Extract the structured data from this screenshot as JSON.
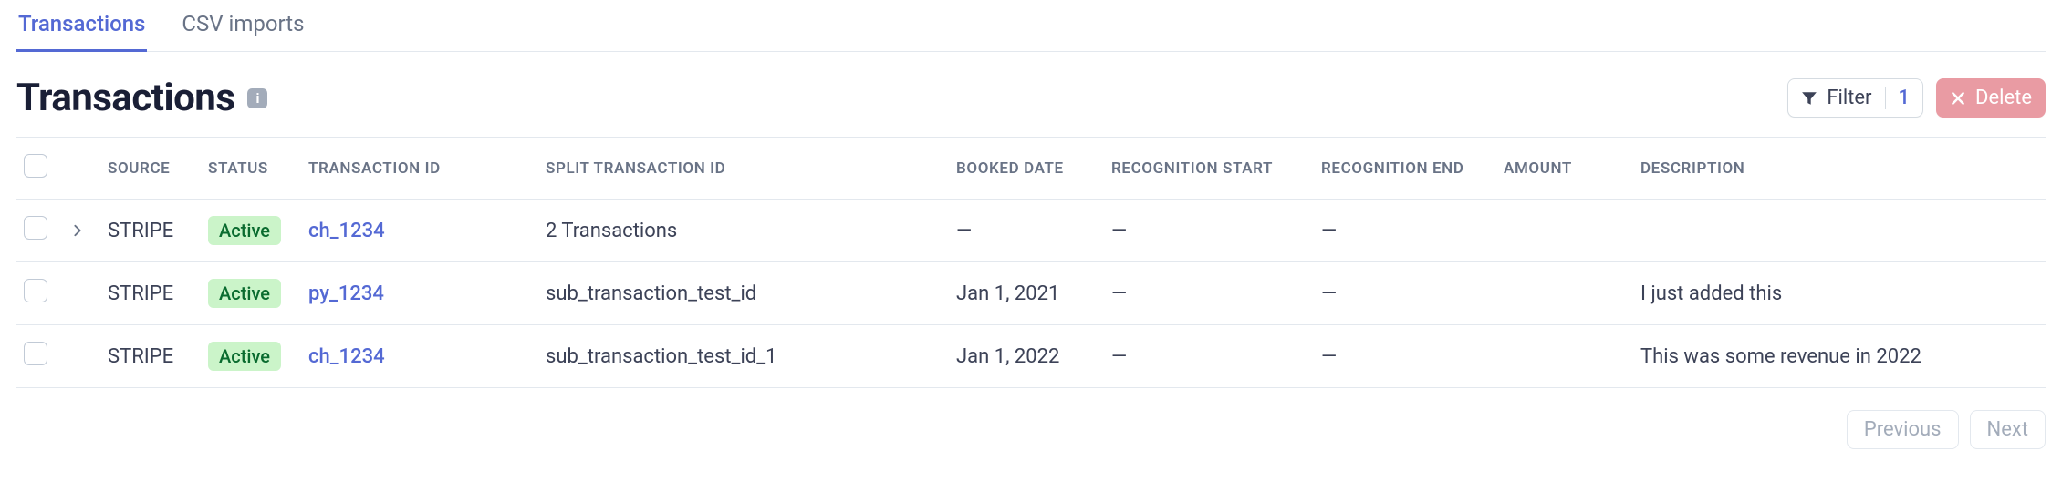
{
  "tabs": [
    {
      "label": "Transactions",
      "active": true
    },
    {
      "label": "CSV imports",
      "active": false
    }
  ],
  "header": {
    "title": "Transactions",
    "info_glyph": "i",
    "filter_label": "Filter",
    "filter_count": "1",
    "delete_label": "Delete"
  },
  "table": {
    "columns": {
      "source": "SOURCE",
      "status": "STATUS",
      "transaction_id": "TRANSACTION ID",
      "split_transaction_id": "SPLIT TRANSACTION ID",
      "booked_date": "BOOKED DATE",
      "recognition_start": "RECOGNITION START",
      "recognition_end": "RECOGNITION END",
      "amount": "AMOUNT",
      "description": "DESCRIPTION"
    },
    "rows": [
      {
        "expandable": true,
        "source": "STRIPE",
        "status": "Active",
        "transaction_id": "ch_1234",
        "split_transaction_id": "2 Transactions",
        "booked_date": "—",
        "recognition_start": "—",
        "recognition_end": "—",
        "amount": "",
        "description": ""
      },
      {
        "expandable": false,
        "source": "STRIPE",
        "status": "Active",
        "transaction_id": "py_1234",
        "split_transaction_id": "sub_transaction_test_id",
        "booked_date": "Jan 1, 2021",
        "recognition_start": "—",
        "recognition_end": "—",
        "amount": "",
        "description": "I just added this"
      },
      {
        "expandable": false,
        "source": "STRIPE",
        "status": "Active",
        "transaction_id": "ch_1234",
        "split_transaction_id": "sub_transaction_test_id_1",
        "booked_date": "Jan 1, 2022",
        "recognition_start": "—",
        "recognition_end": "—",
        "amount": "",
        "description": "This was some revenue in 2022"
      }
    ]
  },
  "pagination": {
    "previous": "Previous",
    "next": "Next"
  },
  "colors": {
    "link": "#5469d4",
    "badge_bg": "#cbf4c9",
    "badge_fg": "#0a6b2f",
    "delete_bg": "#e99ba3"
  }
}
